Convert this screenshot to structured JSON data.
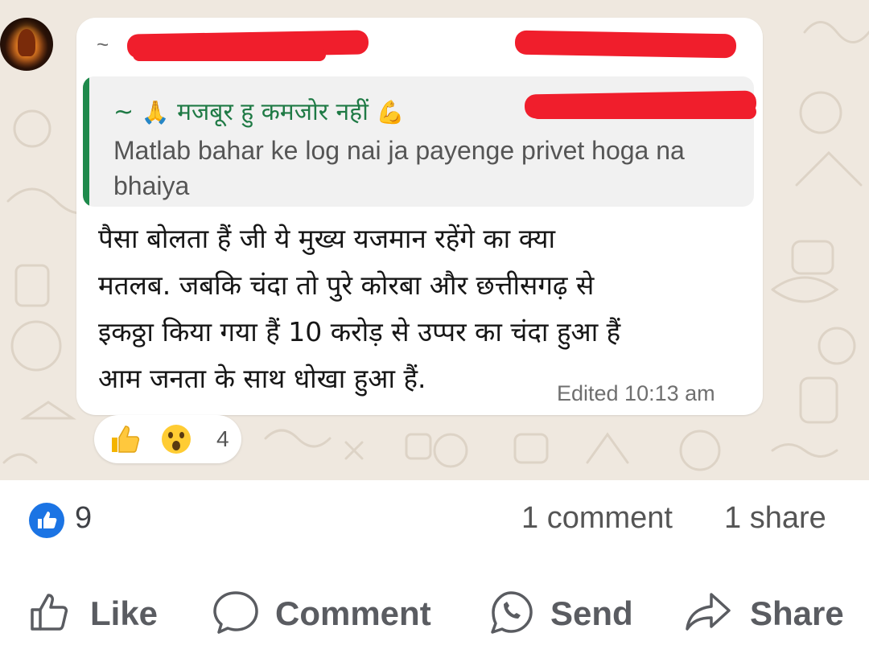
{
  "chat": {
    "sender_prefix": "~",
    "quoted": {
      "prefix": "~",
      "pray_emoji": "🙏",
      "name": "मजबूर हु कमजोर नहीं",
      "muscle_emoji": "💪",
      "text": "Matlab bahar ke log nai ja payenge privet hoga na bhaiya"
    },
    "message": {
      "lines": [
        "पैसा बोलता हैं जी ये मुख्य यजमान रहेंगे का क्या",
        "मतलब. जबकि चंदा तो पुरे कोरबा और छत्तीसगढ़ से",
        "इकठ्ठा किया गया हैं 10 करोड़ से उप्पर का चंदा हुआ हैं",
        "आम जनता के साथ धोखा हुआ हैं."
      ],
      "timestamp": "Edited 10:13 am"
    },
    "reactions": {
      "icons": [
        "thumbs-up",
        "surprised-face"
      ],
      "count": "4"
    }
  },
  "post_stats": {
    "likes": "9",
    "comments": "1 comment",
    "shares": "1 share"
  },
  "actions": {
    "like": "Like",
    "comment": "Comment",
    "send": "Send",
    "share": "Share"
  },
  "colors": {
    "chat_background": "#efe8df",
    "quote_accent": "#1f8a4c",
    "redaction": "#f01e2c",
    "facebook_blue": "#1b74e4"
  }
}
